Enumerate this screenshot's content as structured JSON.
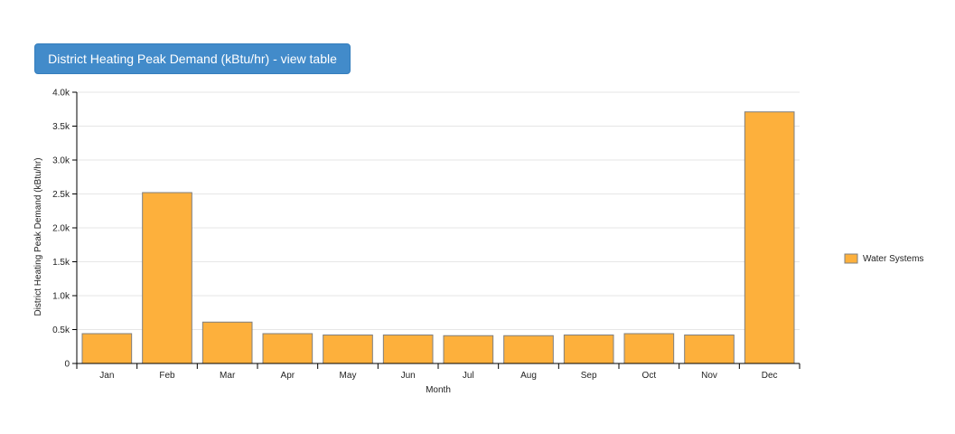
{
  "header": {
    "title_button_label": "District Heating Peak Demand (kBtu/hr) - view table"
  },
  "colors": {
    "bar_fill": "#fdb03c",
    "bar_stroke": "#7f7f7f",
    "grid": "#e6e6e6",
    "button": "#428bca"
  },
  "chart_data": {
    "type": "bar",
    "xlabel": "Month",
    "ylabel": "District Heating Peak Demand (kBtu/hr)",
    "categories": [
      "Jan",
      "Feb",
      "Mar",
      "Apr",
      "May",
      "Jun",
      "Jul",
      "Aug",
      "Sep",
      "Oct",
      "Nov",
      "Dec"
    ],
    "series": [
      {
        "name": "Water Systems",
        "values": [
          440,
          2520,
          610,
          440,
          420,
          420,
          410,
          410,
          420,
          440,
          420,
          3710
        ]
      }
    ],
    "ylim": [
      0,
      4000
    ],
    "yticks": [
      {
        "value": 0,
        "label": "0"
      },
      {
        "value": 500,
        "label": "0.5k"
      },
      {
        "value": 1000,
        "label": "1.0k"
      },
      {
        "value": 1500,
        "label": "1.5k"
      },
      {
        "value": 2000,
        "label": "2.0k"
      },
      {
        "value": 2500,
        "label": "2.5k"
      },
      {
        "value": 3000,
        "label": "3.0k"
      },
      {
        "value": 3500,
        "label": "3.5k"
      },
      {
        "value": 4000,
        "label": "4.0k"
      }
    ],
    "grid": true,
    "legend_position": "right"
  }
}
